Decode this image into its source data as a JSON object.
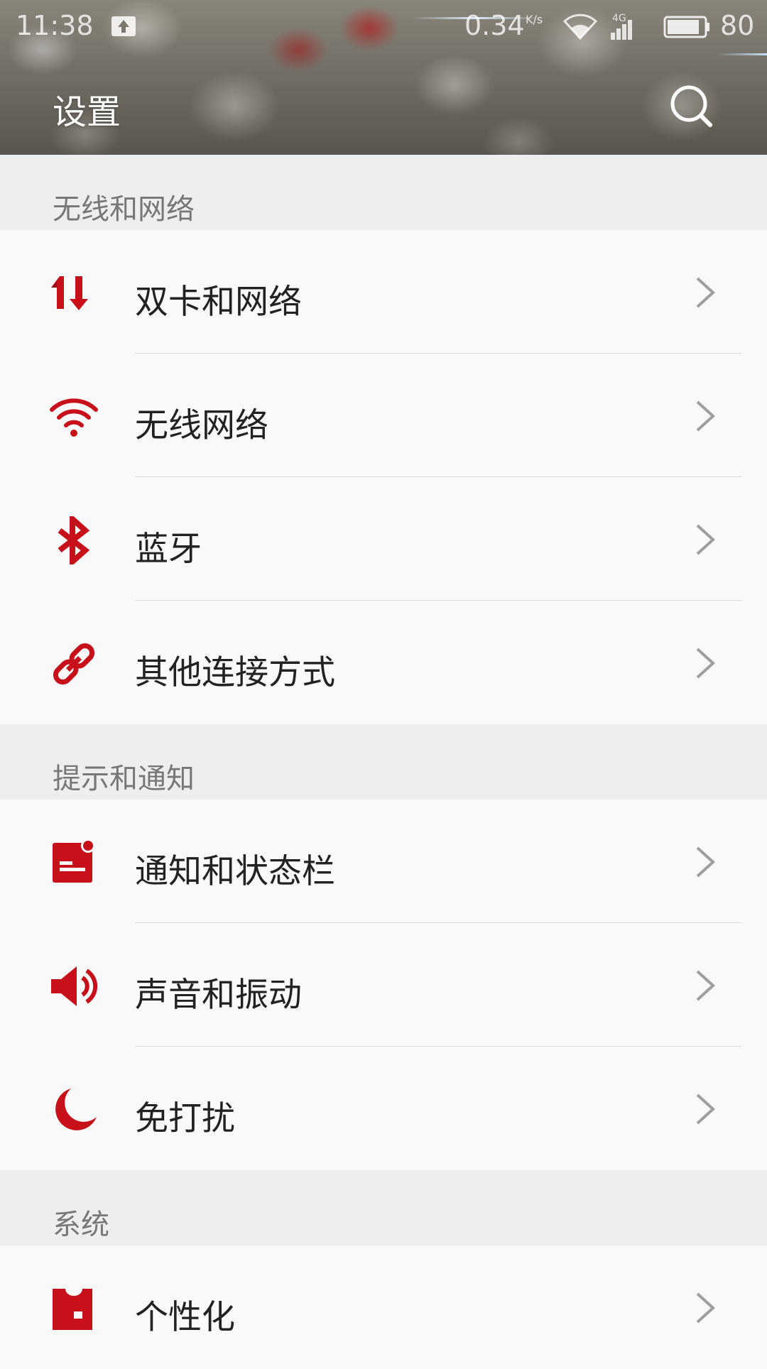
{
  "status_bar": {
    "time": "11:38",
    "net_speed": "0.34",
    "net_speed_unit": "K/s",
    "signal_label": "4G",
    "battery": "80"
  },
  "header": {
    "title": "设置"
  },
  "sections": [
    {
      "title": "无线和网络",
      "items": [
        {
          "label": "双卡和网络",
          "icon": "dual-sim-icon"
        },
        {
          "label": "无线网络",
          "icon": "wifi-icon"
        },
        {
          "label": "蓝牙",
          "icon": "bluetooth-icon"
        },
        {
          "label": "其他连接方式",
          "icon": "link-icon"
        }
      ]
    },
    {
      "title": "提示和通知",
      "items": [
        {
          "label": "通知和状态栏",
          "icon": "notification-icon"
        },
        {
          "label": "声音和振动",
          "icon": "speaker-icon"
        },
        {
          "label": "免打扰",
          "icon": "moon-icon"
        }
      ]
    },
    {
      "title": "系统",
      "items": [
        {
          "label": "个性化",
          "icon": "shirt-icon"
        }
      ]
    }
  ],
  "colors": {
    "accent": "#c8101a",
    "section_bg": "#eeeeee",
    "row_bg": "#f9f9f9",
    "divider": "#d8d8d8",
    "chevron": "#9e9e9e"
  }
}
